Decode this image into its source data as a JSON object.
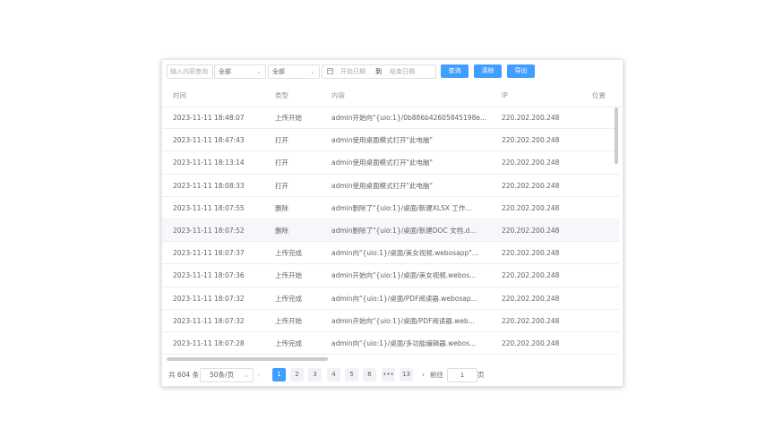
{
  "filters": {
    "content_placeholder": "输入内容查询",
    "type_select": "全部",
    "status_select": "全部",
    "start_date_placeholder": "开始日期",
    "date_separator": "到",
    "end_date_placeholder": "结束日期",
    "query_label": "查询",
    "clear_label": "清除",
    "export_label": "导出"
  },
  "table": {
    "columns": [
      "时间",
      "类型",
      "内容",
      "IP",
      "位置"
    ],
    "rows": [
      {
        "time": "2023-11-11 18:48:07",
        "type": "上传开始",
        "content": "admin开始向\"{uio:1}/0b886b42605845198e...",
        "ip": "220.202.200.248"
      },
      {
        "time": "2023-11-11 18:47:43",
        "type": "打开",
        "content": "admin使用桌面模式打开\"此电脑\"",
        "ip": "220.202.200.248"
      },
      {
        "time": "2023-11-11 18:13:14",
        "type": "打开",
        "content": "admin使用桌面模式打开\"此电脑\"",
        "ip": "220.202.200.248"
      },
      {
        "time": "2023-11-11 18:08:33",
        "type": "打开",
        "content": "admin使用桌面模式打开\"此电脑\"",
        "ip": "220.202.200.248"
      },
      {
        "time": "2023-11-11 18:07:55",
        "type": "删除",
        "content": "admin删除了\"{uio:1}/桌面/新建XLSX 工作...",
        "ip": "220.202.200.248"
      },
      {
        "time": "2023-11-11 18:07:52",
        "type": "删除",
        "content": "admin删除了\"{uio:1}/桌面/新建DOC 文档.d...",
        "ip": "220.202.200.248"
      },
      {
        "time": "2023-11-11 18:07:37",
        "type": "上传完成",
        "content": "admin向\"{uio:1}/桌面/美女视频.webosapp\"...",
        "ip": "220.202.200.248"
      },
      {
        "time": "2023-11-11 18:07:36",
        "type": "上传开始",
        "content": "admin开始向\"{uio:1}/桌面/美女视频.webos...",
        "ip": "220.202.200.248"
      },
      {
        "time": "2023-11-11 18:07:32",
        "type": "上传完成",
        "content": "admin向\"{uio:1}/桌面/PDF阅读器.webosap...",
        "ip": "220.202.200.248"
      },
      {
        "time": "2023-11-11 18:07:32",
        "type": "上传开始",
        "content": "admin开始向\"{uio:1}/桌面/PDF阅读器.web...",
        "ip": "220.202.200.248"
      },
      {
        "time": "2023-11-11 18:07:28",
        "type": "上传完成",
        "content": "admin向\"{uio:1}/桌面/多功能编辑器.webos...",
        "ip": "220.202.200.248"
      }
    ],
    "highlighted_row": 5
  },
  "pagination": {
    "total": "共 604 条",
    "page_size": "50条/页",
    "pages": [
      "1",
      "2",
      "3",
      "4",
      "5",
      "6",
      "•••",
      "13"
    ],
    "active_page": "1",
    "goto_label": "前往",
    "goto_value": "1",
    "page_suffix": "页"
  },
  "colors": {
    "primary": "#409eff",
    "border": "#ebeef5",
    "text": "#606266",
    "header_text": "#909399"
  }
}
